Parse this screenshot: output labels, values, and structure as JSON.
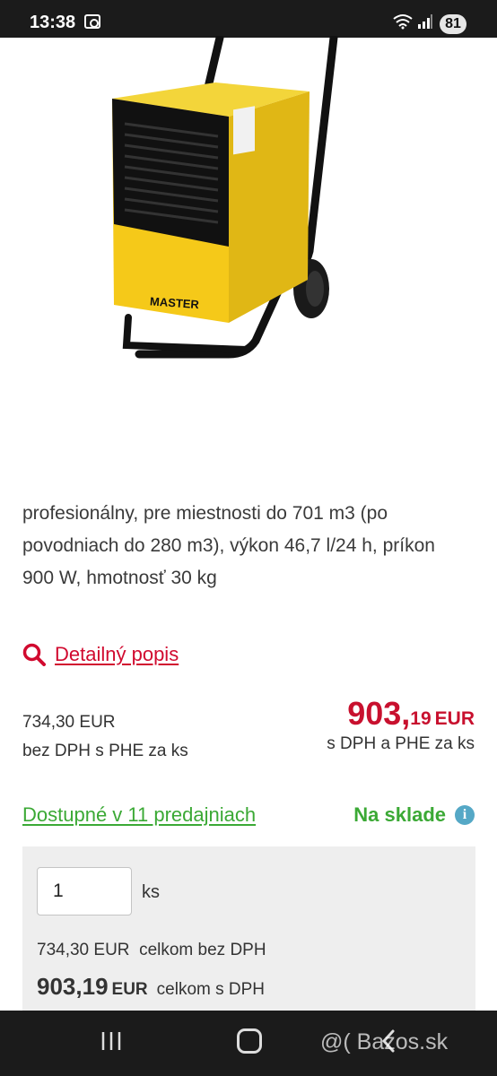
{
  "status_bar": {
    "time": "13:38",
    "battery": "81"
  },
  "product": {
    "brand_on_image": "MASTER",
    "description": "profesionálny, pre miestnosti do 701 m3 (po povodniach do 280 m3), výkon 46,7 l/24 h, príkon 900 W, hmotnosť 30 kg"
  },
  "detail_link": {
    "label": "Detailný popis",
    "icon": "search-icon"
  },
  "pricing": {
    "without_vat": "734,30 EUR",
    "without_vat_note": "bez DPH s PHE za ks",
    "with_vat_int": "903,",
    "with_vat_dec": "19",
    "with_vat_currency": "EUR",
    "with_vat_note": "s DPH a PHE za ks",
    "accent_color": "#c8102e"
  },
  "availability": {
    "link": "Dostupné v 11 predajniach",
    "status": "Na sklade",
    "info_icon": "i",
    "color": "#3ba935"
  },
  "cart": {
    "quantity": "1",
    "unit": "ks",
    "total_without_vat": "734,30 EUR",
    "total_without_vat_note": "celkom bez DPH",
    "total_with_vat": "903,19",
    "total_with_vat_currency": "EUR",
    "total_with_vat_note": "celkom s DPH"
  },
  "watermark": "@( Bazos.sk"
}
